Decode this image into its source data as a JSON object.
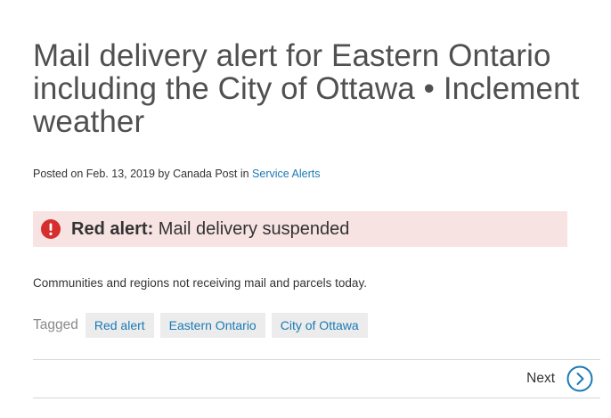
{
  "article": {
    "title": "Mail delivery alert for Eastern Ontario including the City of Ottawa • Inclement weather",
    "meta": {
      "posted_prefix": "Posted on ",
      "date": "Feb. 13, 2019",
      "by_text": " by ",
      "author": "Canada Post",
      "in_text": " in ",
      "category": "Service Alerts"
    },
    "alert": {
      "icon": "exclamation-circle-icon",
      "label": "Red alert:",
      "message": " Mail delivery suspended",
      "icon_color": "#d62d2d",
      "background": "#f8e3e3"
    },
    "body": "Communities and regions not receiving mail and parcels today.",
    "tags": {
      "label": "Tagged",
      "items": [
        "Red alert",
        "Eastern Ontario",
        "City of Ottawa"
      ]
    }
  },
  "navigation": {
    "next_label": "Next",
    "next_icon": "chevron-right-circle-icon"
  },
  "colors": {
    "link": "#1a7ab5",
    "title": "#505050",
    "text": "#333333"
  }
}
